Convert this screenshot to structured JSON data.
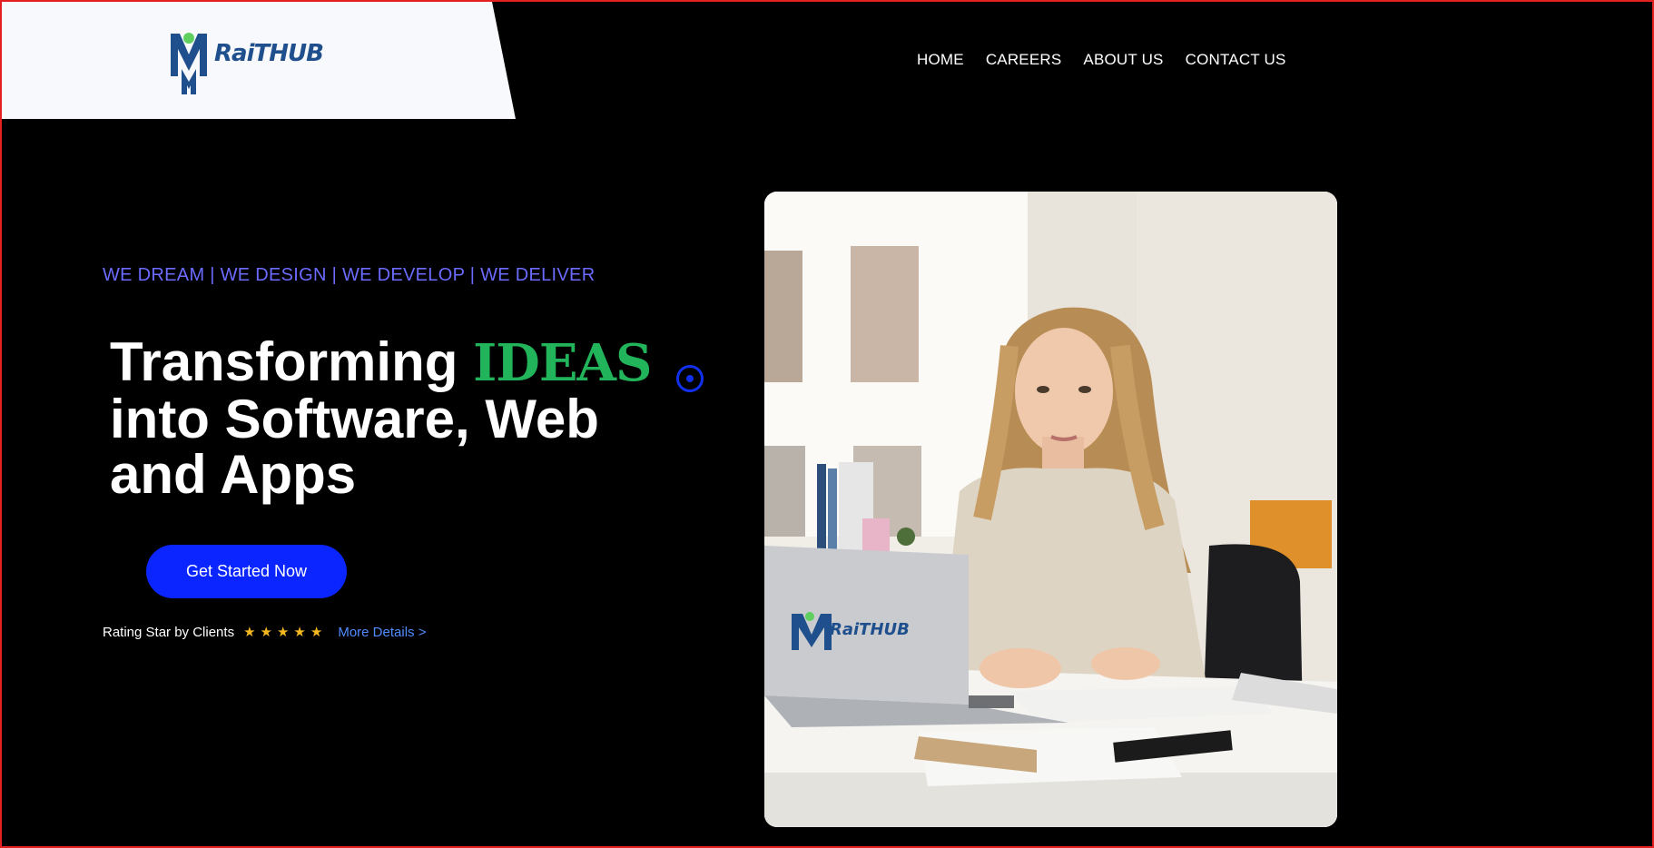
{
  "brand": {
    "logo_text": "RaiTHUB"
  },
  "nav": {
    "items": [
      {
        "label": "HOME"
      },
      {
        "label": "CAREERS"
      },
      {
        "label": "ABOUT US"
      },
      {
        "label": "CONTACT US"
      }
    ]
  },
  "hero": {
    "tagline": "WE DREAM | WE DESIGN | WE DEVELOP | WE DELIVER",
    "headline_part1": "Transforming ",
    "headline_accent": "IDEAS",
    "headline_part2": "into Software, Web and Apps",
    "cta_label": "Get Started Now",
    "rating_label": "Rating Star by Clients",
    "rating_value": 5,
    "rating_stars": "★★★★★",
    "more_link": "More Details >",
    "image_laptop_logo": "RaiTHUB"
  },
  "colors": {
    "accent_green": "#22b45a",
    "tagline_blue": "#6b6bff",
    "cta_blue": "#0a25ff",
    "star_gold": "#f5b820",
    "link_blue": "#4f8cff",
    "frame_red": "#e52020"
  }
}
